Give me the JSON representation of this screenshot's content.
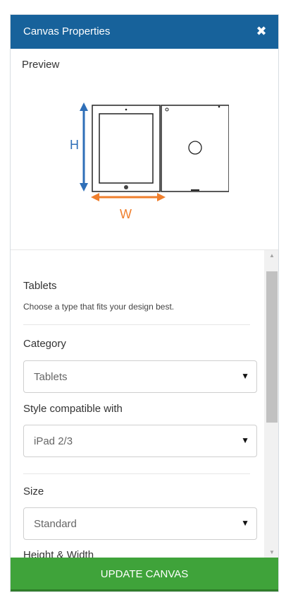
{
  "header": {
    "title": "Canvas Properties",
    "close_icon": "close-icon"
  },
  "preview": {
    "label": "Preview",
    "height_label": "H",
    "width_label": "W"
  },
  "section": {
    "title": "Tablets",
    "description": "Choose a type that fits your design best."
  },
  "fields": {
    "category": {
      "label": "Category",
      "value": "Tablets"
    },
    "style": {
      "label": "Style compatible with",
      "value": "iPad 2/3"
    },
    "size": {
      "label": "Size",
      "value": "Standard"
    },
    "dimensions": {
      "label": "Height & Width"
    }
  },
  "footer": {
    "update_label": "UPDATE CANVAS"
  },
  "colors": {
    "header": "#17629b",
    "button": "#3fa33a",
    "arrow_height": "#2f6fb8",
    "arrow_width": "#f07f2d"
  }
}
